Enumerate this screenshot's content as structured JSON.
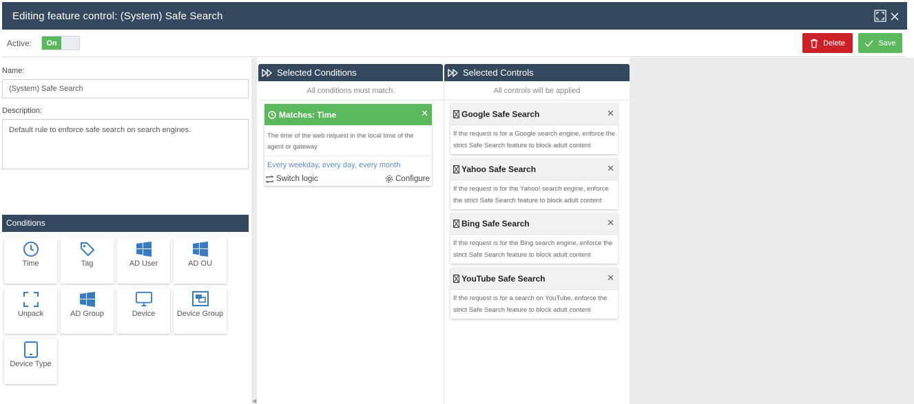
{
  "window": {
    "title": "Editing feature control: (System) Safe Search"
  },
  "toolbar": {
    "active_label": "Active:",
    "toggle_on": "On",
    "delete_label": "Delete",
    "save_label": "Save"
  },
  "form": {
    "name_label": "Name:",
    "name_value": "(System) Safe Search",
    "description_label": "Description:",
    "description_value": "Default rule to enforce safe search on search engines."
  },
  "conditions_panel": {
    "title": "Conditions",
    "items": [
      {
        "label": "Time",
        "icon": "clock-icon"
      },
      {
        "label": "Tag",
        "icon": "tag-icon"
      },
      {
        "label": "AD User",
        "icon": "windows-icon"
      },
      {
        "label": "AD OU",
        "icon": "windows-icon"
      },
      {
        "label": "Unpack",
        "icon": "expand-icon"
      },
      {
        "label": "AD Group",
        "icon": "windows-icon"
      },
      {
        "label": "Device",
        "icon": "monitor-icon"
      },
      {
        "label": "Device Group",
        "icon": "device-group-icon"
      },
      {
        "label": "Device Type",
        "icon": "tablet-icon"
      }
    ]
  },
  "selected_conditions": {
    "title": "Selected Conditions",
    "subtitle": "All conditions must match.",
    "cards": [
      {
        "title": "Matches: Time",
        "description": "The time of the web request in the local time of the agent or gateway",
        "schedule": "Every weekday, every day, every month",
        "switch_logic": "Switch logic",
        "configure": "Configure"
      }
    ]
  },
  "selected_controls": {
    "title": "Selected Controls",
    "subtitle": "All controls will be applied",
    "cards": [
      {
        "title": "Google Safe Search",
        "description": "If the request is for a Google search engine, enforce the strict Safe Search feature to block adult content"
      },
      {
        "title": "Yahoo Safe Search",
        "description": "If the request is for the Yahoo! search engine, enforce the strict Safe Search feature to block adult content"
      },
      {
        "title": "Bing Safe Search",
        "description": "If the request is for the Bing search engine, enforce the strict Safe Search feature to block adult content"
      },
      {
        "title": "YouTube Safe Search",
        "description": "If the request is for a search on YouTube, enforce the strict Safe Search feature to block adult content"
      }
    ]
  },
  "colors": {
    "header": "#34495e",
    "green": "#5cb85c",
    "red": "#cc2227",
    "icon_blue": "#3a7bbf"
  }
}
